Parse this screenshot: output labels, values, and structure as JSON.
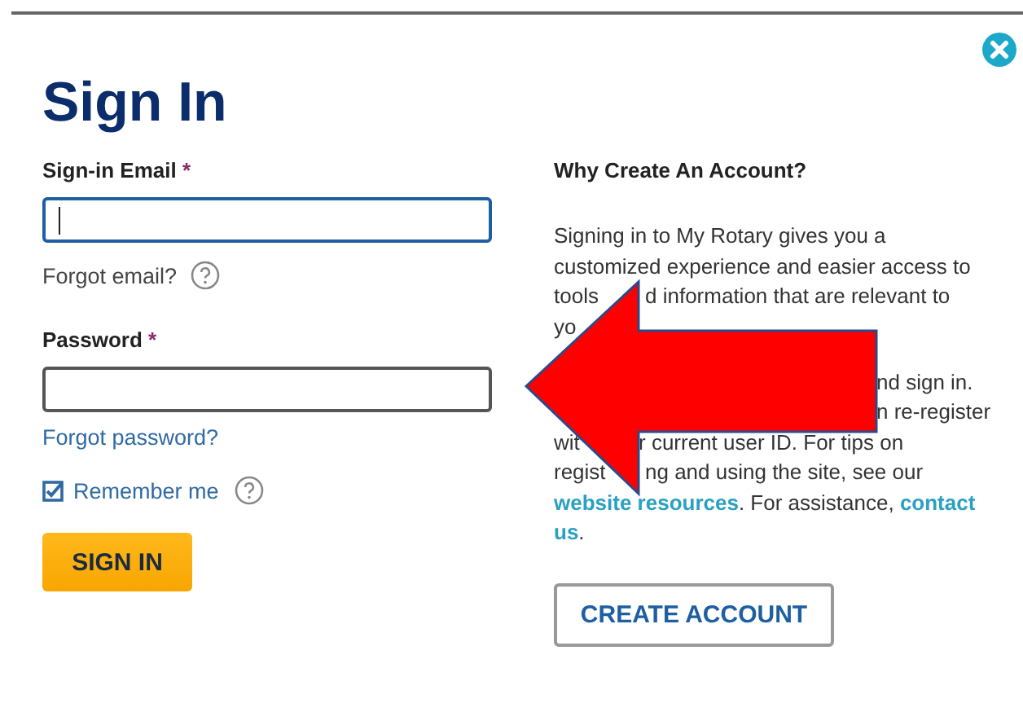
{
  "title": "Sign In",
  "email": {
    "label": "Sign-in Email",
    "required": "*",
    "focused": true,
    "hint": "Forgot email?"
  },
  "password": {
    "label": "Password",
    "required": "*",
    "focused": false,
    "link": "Forgot password?"
  },
  "remember": {
    "label": "Remember me",
    "checked": true
  },
  "submit": "SIGN IN",
  "aside": {
    "heading": "Why Create An Account?",
    "paragraphs": [
      [
        [
          {
            "text": "Signing in to My Rotary gives you a"
          }
        ],
        [
          {
            "text": "customized experience and easier access to"
          }
        ],
        [
          {
            "text": "tools"
          },
          {
            "text": "d information that are relevant to"
          }
        ],
        [
          {
            "text": "yo"
          }
        ]
      ],
      [
        [
          {
            "text": "nd sign in."
          }
        ],
        [
          {
            "text": "n re-register"
          }
        ],
        [
          {
            "text": "wit"
          },
          {
            "text": "r current user ID. For tips on"
          }
        ],
        [
          {
            "text": "regist"
          },
          {
            "text": "ng and using the site, see our"
          }
        ],
        [
          {
            "text": "website resources",
            "link": true
          },
          {
            "text": ". For assistance, "
          },
          {
            "text": "contact",
            "link": true
          }
        ],
        [
          {
            "text": "us",
            "link": true
          },
          {
            "text": "."
          }
        ]
      ]
    ],
    "button": "CREATE ACCOUNT"
  },
  "overlay": {
    "kind": "arrow"
  }
}
